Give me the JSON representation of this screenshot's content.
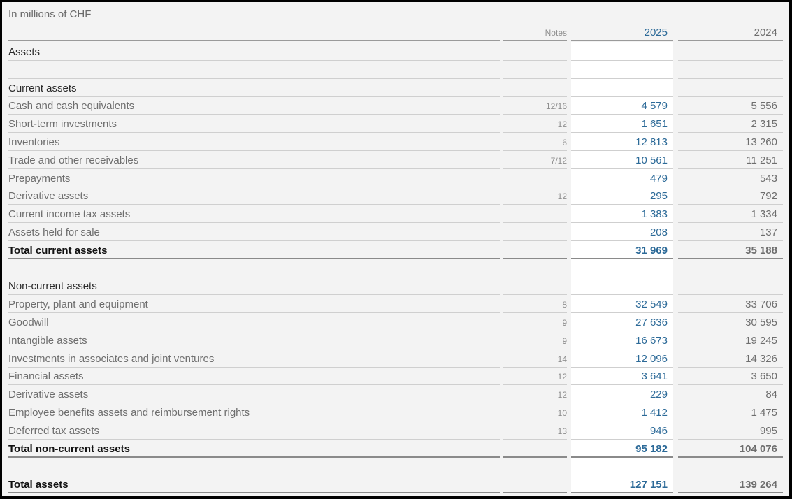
{
  "unit_label": "In millions of CHF",
  "columns": {
    "notes": "Notes",
    "y2025": "2025",
    "y2024": "2024"
  },
  "rows": [
    {
      "type": "section",
      "label": "Assets",
      "notes": "",
      "v2025": "",
      "v2024": ""
    },
    {
      "type": "blank",
      "label": "",
      "notes": "",
      "v2025": "",
      "v2024": ""
    },
    {
      "type": "section",
      "label": "Current assets",
      "notes": "",
      "v2025": "",
      "v2024": ""
    },
    {
      "type": "item",
      "label": "Cash and cash equivalents",
      "notes": "12/16",
      "v2025": "4 579",
      "v2024": "5 556"
    },
    {
      "type": "item",
      "label": "Short-term investments",
      "notes": "12",
      "v2025": "1 651",
      "v2024": "2 315"
    },
    {
      "type": "item",
      "label": "Inventories",
      "notes": "6",
      "v2025": "12 813",
      "v2024": "13 260"
    },
    {
      "type": "item",
      "label": "Trade and other receivables",
      "notes": "7/12",
      "v2025": "10 561",
      "v2024": "11 251"
    },
    {
      "type": "item",
      "label": "Prepayments",
      "notes": "",
      "v2025": "479",
      "v2024": "543"
    },
    {
      "type": "item",
      "label": "Derivative assets",
      "notes": "12",
      "v2025": "295",
      "v2024": "792"
    },
    {
      "type": "item",
      "label": "Current income tax assets",
      "notes": "",
      "v2025": "1 383",
      "v2024": "1 334"
    },
    {
      "type": "item",
      "label": "Assets held for sale",
      "notes": "",
      "v2025": "208",
      "v2024": "137"
    },
    {
      "type": "total",
      "label": "Total current assets",
      "notes": "",
      "v2025": "31 969",
      "v2024": "35 188"
    },
    {
      "type": "blank",
      "label": "",
      "notes": "",
      "v2025": "",
      "v2024": ""
    },
    {
      "type": "section",
      "label": "Non-current assets",
      "notes": "",
      "v2025": "",
      "v2024": ""
    },
    {
      "type": "item",
      "label": "Property, plant and equipment",
      "notes": "8",
      "v2025": "32 549",
      "v2024": "33 706"
    },
    {
      "type": "item",
      "label": "Goodwill",
      "notes": "9",
      "v2025": "27 636",
      "v2024": "30 595"
    },
    {
      "type": "item",
      "label": "Intangible assets",
      "notes": "9",
      "v2025": "16 673",
      "v2024": "19 245"
    },
    {
      "type": "item",
      "label": "Investments in associates and joint ventures",
      "notes": "14",
      "v2025": "12 096",
      "v2024": "14 326"
    },
    {
      "type": "item",
      "label": "Financial assets",
      "notes": "12",
      "v2025": "3 641",
      "v2024": "3 650"
    },
    {
      "type": "item",
      "label": "Derivative assets",
      "notes": "12",
      "v2025": "229",
      "v2024": "84"
    },
    {
      "type": "item",
      "label": "Employee benefits assets and reimbursement rights",
      "notes": "10",
      "v2025": "1 412",
      "v2024": "1 475"
    },
    {
      "type": "item",
      "label": "Deferred tax assets",
      "notes": "13",
      "v2025": "946",
      "v2024": "995"
    },
    {
      "type": "total",
      "label": "Total non-current assets",
      "notes": "",
      "v2025": "95 182",
      "v2024": "104 076"
    },
    {
      "type": "blank",
      "label": "",
      "notes": "",
      "v2025": "",
      "v2024": ""
    },
    {
      "type": "total",
      "label": "Total assets",
      "notes": "",
      "v2025": "127 151",
      "v2024": "139 264"
    }
  ]
}
